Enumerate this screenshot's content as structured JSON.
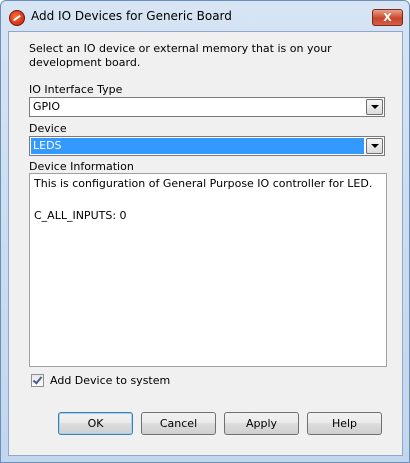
{
  "window": {
    "title": "Add IO Devices for Generic Board",
    "close_label": "X"
  },
  "description": "Select an IO device or external memory that is on your development board.",
  "interface_type": {
    "label": "IO Interface Type",
    "value": "GPIO"
  },
  "device": {
    "label": "Device",
    "value": "LEDS"
  },
  "device_info": {
    "label": "Device Information",
    "text": "This is configuration of General Purpose IO controller for LED.\n\nC_ALL_INPUTS: 0"
  },
  "add_device": {
    "label": "Add Device to system",
    "checked": true
  },
  "buttons": {
    "ok": "OK",
    "cancel": "Cancel",
    "apply": "Apply",
    "help": "Help"
  }
}
